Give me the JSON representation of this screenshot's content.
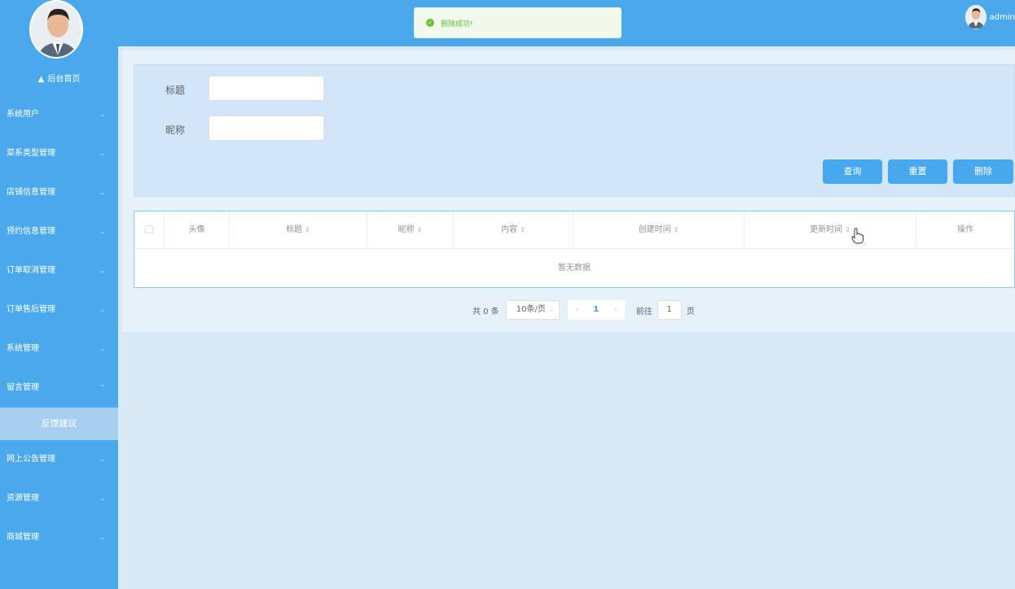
{
  "sidebar": {
    "home_label": "后台首页",
    "menu": [
      {
        "label": "系统用户"
      },
      {
        "label": "菜系类型管理"
      },
      {
        "label": "店铺信息管理"
      },
      {
        "label": "预约信息管理"
      },
      {
        "label": "订单取消管理"
      },
      {
        "label": "订单售后管理"
      },
      {
        "label": "系统管理"
      },
      {
        "label": "留言管理"
      }
    ],
    "submenu_active": "反馈建议",
    "menu_after": [
      {
        "label": "网上公告管理"
      },
      {
        "label": "资源管理"
      },
      {
        "label": "商城管理"
      }
    ]
  },
  "header": {
    "toast_text": "删除成功!",
    "username": "admin"
  },
  "search": {
    "title_label": "标题",
    "nickname_label": "昵称",
    "query_button": "查询",
    "reset_button": "重置",
    "delete_button": "删除"
  },
  "table": {
    "columns": [
      "头像",
      "标题",
      "昵称",
      "内容",
      "创建时间",
      "更新时间",
      "操作"
    ],
    "empty_text": "暂无数据"
  },
  "pagination": {
    "total_text": "共 0 条",
    "page_size": "10条/页",
    "current_page": "1",
    "goto_label": "前往",
    "goto_value": "1",
    "page_suffix": "页"
  },
  "colors": {
    "sidebar": "#4aa9ec",
    "header": "#4aa9ec",
    "button": "#47a8ee",
    "success": "#67c23a"
  }
}
